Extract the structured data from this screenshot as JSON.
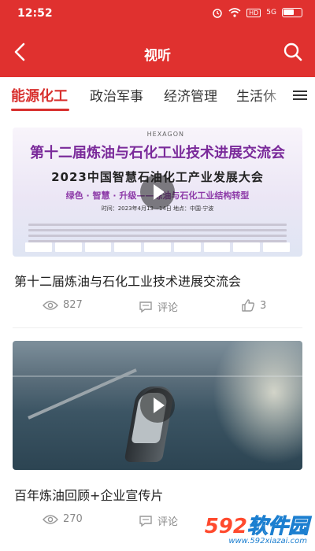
{
  "status_bar": {
    "time": "12:52",
    "icons": [
      "alarm-icon",
      "wifi-icon",
      "hd-icon",
      "signal-icon",
      "battery-icon"
    ],
    "hd_label": "HD",
    "signal_label": "5G"
  },
  "nav": {
    "title": "视听",
    "back_icon": "chevron-left-icon",
    "search_icon": "search-icon"
  },
  "tabs": {
    "items": [
      {
        "label": "能源化工",
        "active": true
      },
      {
        "label": "政治军事",
        "active": false
      },
      {
        "label": "经济管理",
        "active": false
      },
      {
        "label": "生活休",
        "active": false
      }
    ],
    "menu_icon": "menu-icon"
  },
  "videos": [
    {
      "title": "第十二届炼油与石化工业技术进展交流会",
      "thumbnail": {
        "logo_text": "HEXAGON",
        "title_line1": "第十二届炼油与石化工业技术进展交流会",
        "title_line2": "2023中国智慧石油化工产业发展大会",
        "subtitle": "绿色 · 智慧 · 升级——炼油与石化工业结构转型",
        "info": "时间：2023年4月13—14日    地点：中国·宁波"
      },
      "views": "827",
      "comment_label": "评论",
      "likes": "3"
    },
    {
      "title": "百年炼油回顾+企业宣传片",
      "views": "270",
      "comment_label": "评论"
    }
  ],
  "watermark": {
    "number": "592",
    "text": "软件园",
    "url": "www.592xiazai.com"
  },
  "colors": {
    "brand_red": "#e0312f",
    "tab_active": "#d8302e"
  }
}
